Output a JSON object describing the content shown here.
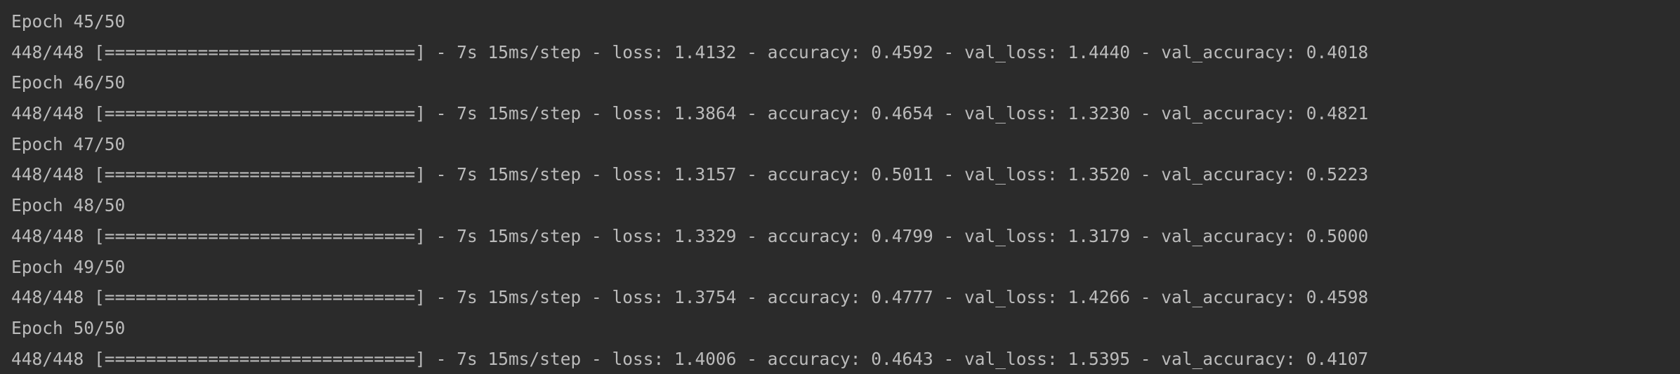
{
  "console": {
    "lines": [
      "Epoch 45/50",
      "448/448 [==============================] - 7s 15ms/step - loss: 1.4132 - accuracy: 0.4592 - val_loss: 1.4440 - val_accuracy: 0.4018",
      "Epoch 46/50",
      "448/448 [==============================] - 7s 15ms/step - loss: 1.3864 - accuracy: 0.4654 - val_loss: 1.3230 - val_accuracy: 0.4821",
      "Epoch 47/50",
      "448/448 [==============================] - 7s 15ms/step - loss: 1.3157 - accuracy: 0.5011 - val_loss: 1.3520 - val_accuracy: 0.5223",
      "Epoch 48/50",
      "448/448 [==============================] - 7s 15ms/step - loss: 1.3329 - accuracy: 0.4799 - val_loss: 1.3179 - val_accuracy: 0.5000",
      "Epoch 49/50",
      "448/448 [==============================] - 7s 15ms/step - loss: 1.3754 - accuracy: 0.4777 - val_loss: 1.4266 - val_accuracy: 0.4598",
      "Epoch 50/50",
      "448/448 [==============================] - 7s 15ms/step - loss: 1.4006 - accuracy: 0.4643 - val_loss: 1.5395 - val_accuracy: 0.4107"
    ]
  },
  "colors": {
    "background": "#2b2b2b",
    "text": "#bbbbbb"
  }
}
